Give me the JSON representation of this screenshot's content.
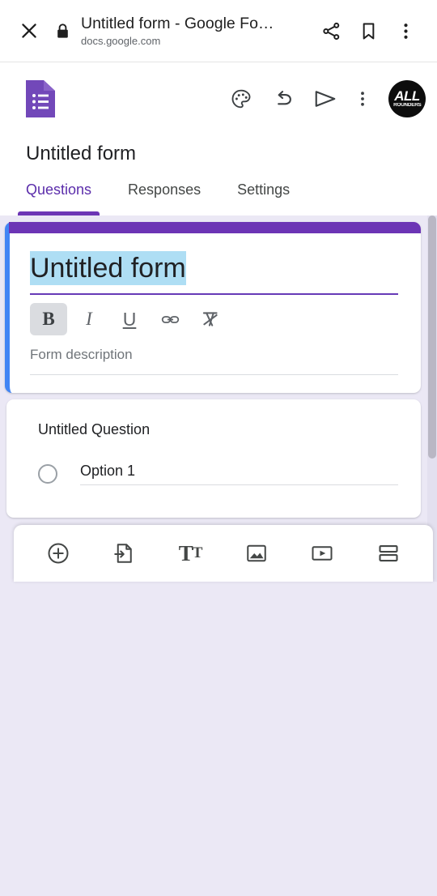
{
  "browser": {
    "close_icon": "close-icon",
    "lock_icon": "lock-icon",
    "page_title": "Untitled form - Google Fo…",
    "url": "docs.google.com",
    "share_icon": "share-icon",
    "bookmark_icon": "bookmark-icon",
    "overflow_icon": "more-vert-icon"
  },
  "app_toolbar": {
    "logo_icon": "google-forms-logo-icon",
    "theme_icon": "palette-icon",
    "undo_icon": "undo-icon",
    "send_icon": "send-icon",
    "more_icon": "more-vert-icon",
    "avatar": {
      "line1": "ALL",
      "line2": "ROUNDERS"
    }
  },
  "header": {
    "form_name": "Untitled form"
  },
  "tabs": [
    {
      "label": "Questions",
      "active": true
    },
    {
      "label": "Responses",
      "active": false
    },
    {
      "label": "Settings",
      "active": false
    }
  ],
  "form_card": {
    "title_value": "Untitled form",
    "title_selected": true,
    "description_placeholder": "Form description",
    "format_toolbar": [
      {
        "name": "bold-button",
        "label": "B",
        "active": true
      },
      {
        "name": "italic-button",
        "label": "I",
        "active": false
      },
      {
        "name": "underline-button",
        "label": "U",
        "active": false
      },
      {
        "name": "link-button",
        "label": "link-icon",
        "active": false
      },
      {
        "name": "clear-formatting-button",
        "label": "clear-format-icon",
        "active": false
      }
    ]
  },
  "question_card": {
    "question_title": "Untitled Question",
    "options": [
      {
        "label": "Option 1"
      }
    ]
  },
  "float_toolbar": [
    {
      "name": "add-question-button",
      "icon": "plus-circle-icon"
    },
    {
      "name": "import-questions-button",
      "icon": "import-document-icon"
    },
    {
      "name": "add-title-description-button",
      "icon": "title-text-icon"
    },
    {
      "name": "add-image-button",
      "icon": "image-icon"
    },
    {
      "name": "add-video-button",
      "icon": "video-icon"
    },
    {
      "name": "add-section-button",
      "icon": "section-icon"
    }
  ],
  "colors": {
    "background": "#ebe8f5",
    "accent_purple": "#6c35b5",
    "selected_blue": "#4285f4",
    "highlight": "#aedef4"
  }
}
